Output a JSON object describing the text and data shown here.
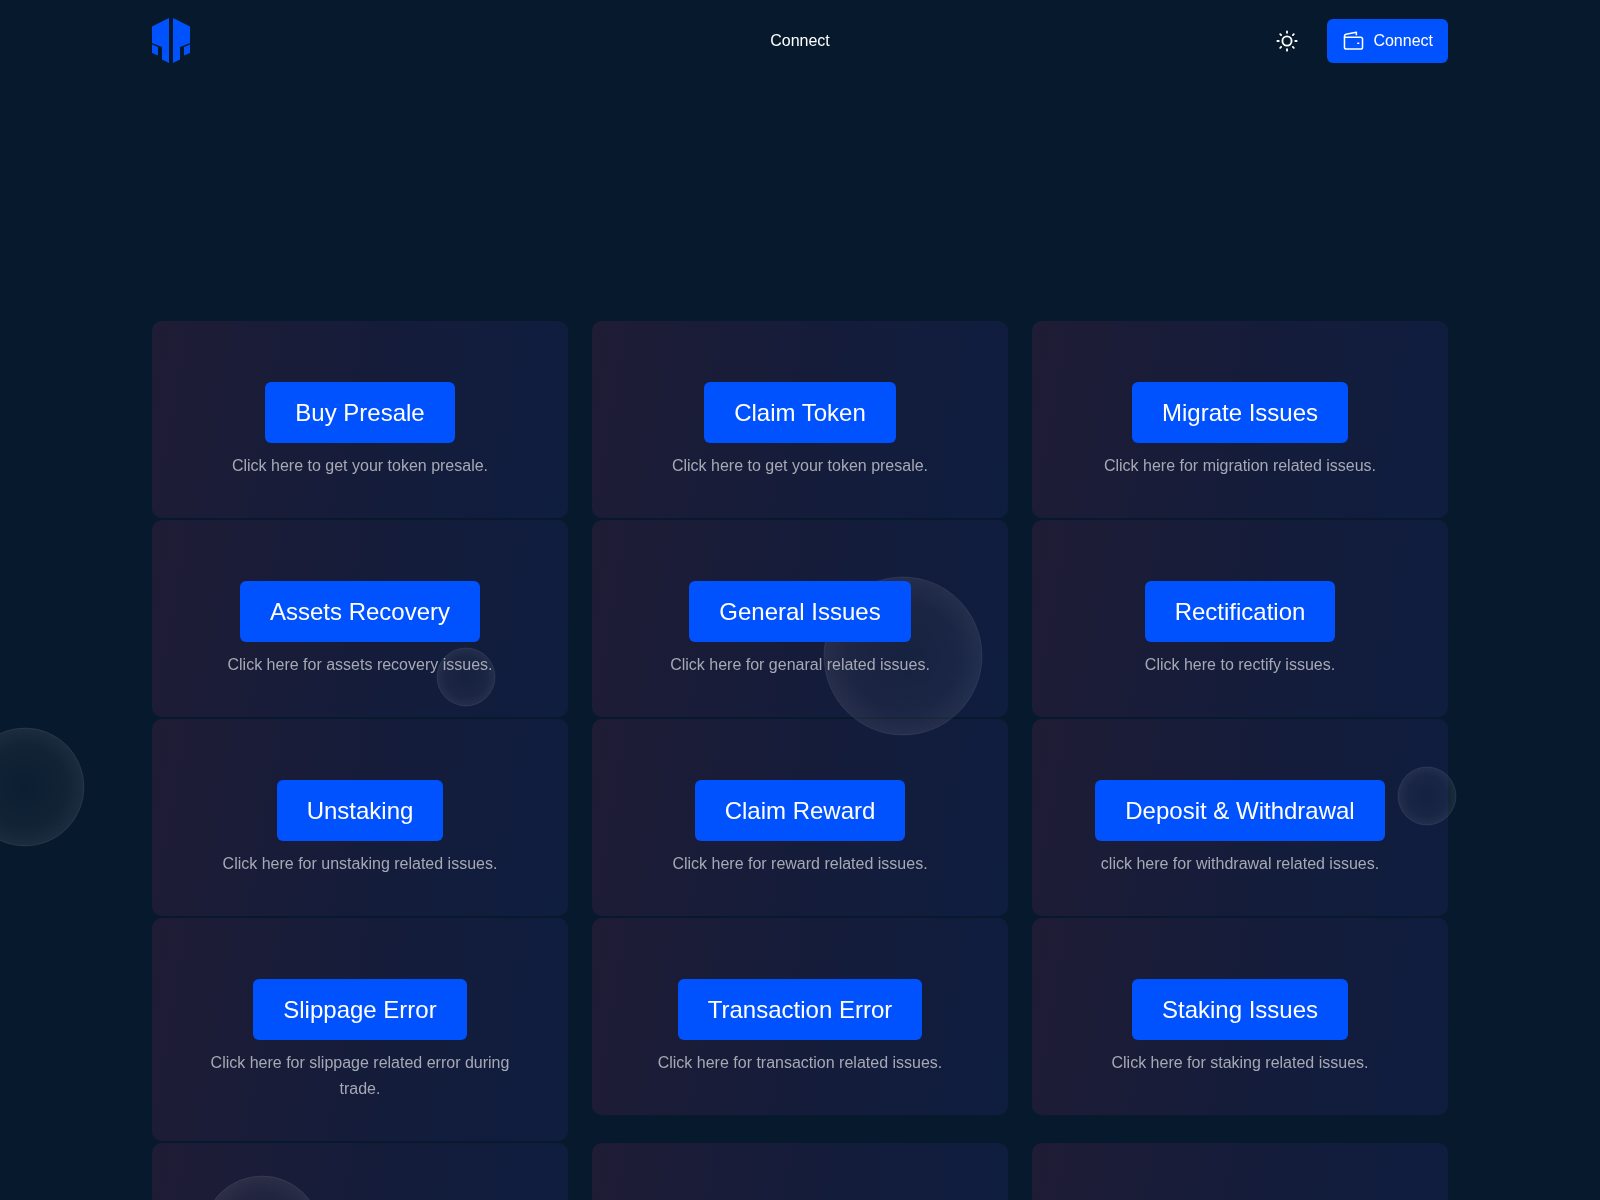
{
  "header": {
    "nav_link": "Connect",
    "connect_button": "Connect"
  },
  "cards": [
    {
      "kind": "action",
      "button": "Buy Presale",
      "description": "Click here to get your token presale."
    },
    {
      "kind": "action",
      "button": "Claim Token",
      "description": "Click here to get your token presale."
    },
    {
      "kind": "action",
      "button": "Migrate Issues",
      "description": "Click here for migration related isseus."
    },
    {
      "kind": "action",
      "button": "Assets Recovery",
      "description": "Click here for assets recovery issues."
    },
    {
      "kind": "action",
      "button": "General Issues",
      "description": "Click here for genaral related issues."
    },
    {
      "kind": "action",
      "button": "Rectification",
      "description": "Click here to rectify issues."
    },
    {
      "kind": "action",
      "button": "Unstaking",
      "description": "Click here for unstaking related issues."
    },
    {
      "kind": "action",
      "button": "Claim Reward",
      "description": "Click here for reward related issues."
    },
    {
      "kind": "action",
      "button": "Deposit & Withdrawal",
      "description": "click here for withdrawal related issues."
    },
    {
      "kind": "action",
      "button": "Slippage Error",
      "description": "Click here for slippage related error during trade."
    },
    {
      "kind": "action",
      "button": "Transaction Error",
      "description": "Click here for transaction related issues."
    },
    {
      "kind": "action",
      "button": "Staking Issues",
      "description": "Click here for staking related issues."
    },
    {
      "kind": "clipped"
    },
    {
      "kind": "clipped"
    },
    {
      "kind": "clipped"
    }
  ]
}
